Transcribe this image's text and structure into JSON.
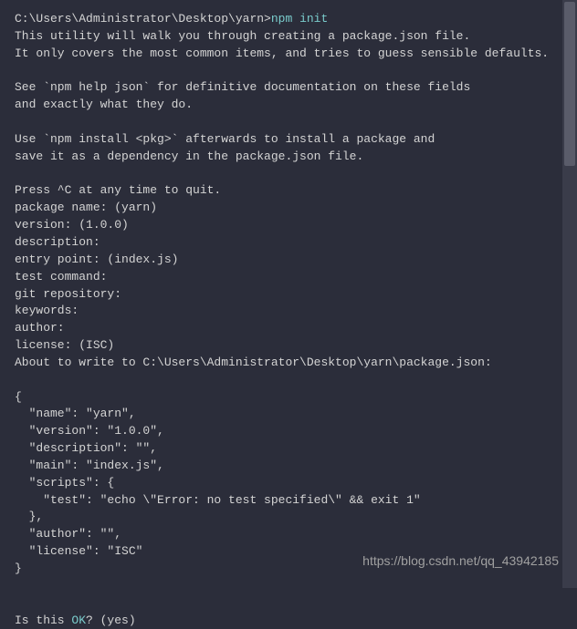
{
  "terminal": {
    "prompt_path": "C:\\Users\\Administrator\\Desktop\\yarn>",
    "command": "npm init",
    "intro_line1": "This utility will walk you through creating a package.json file.",
    "intro_line2": "It only covers the most common items, and tries to guess sensible defaults.",
    "help_line1": "See `npm help json` for definitive documentation on these fields",
    "help_line2": "and exactly what they do.",
    "install_line1": "Use `npm install <pkg>` afterwards to install a package and",
    "install_line2": "save it as a dependency in the package.json file.",
    "quit_line": "Press ^C at any time to quit.",
    "prompts": {
      "package_name": "package name: (yarn)",
      "version": "version: (1.0.0)",
      "description": "description:",
      "entry_point": "entry point: (index.js)",
      "test_command": "test command:",
      "git_repository": "git repository:",
      "keywords": "keywords:",
      "author": "author:",
      "license": "license: (ISC)"
    },
    "about_to_write": "About to write to C:\\Users\\Administrator\\Desktop\\yarn\\package.json:",
    "json_output": {
      "open_brace": "{",
      "name": "  \"name\": \"yarn\",",
      "version": "  \"version\": \"1.0.0\",",
      "description": "  \"description\": \"\",",
      "main": "  \"main\": \"index.js\",",
      "scripts_open": "  \"scripts\": {",
      "test": "    \"test\": \"echo \\\"Error: no test specified\\\" && exit 1\"",
      "scripts_close": "  },",
      "author": "  \"author\": \"\",",
      "license": "  \"license\": \"ISC\"",
      "close_brace": "}"
    },
    "confirm_prefix": "Is this ",
    "confirm_ok": "OK",
    "confirm_suffix": "? (yes)"
  },
  "watermark": "https://blog.csdn.net/qq_43942185"
}
